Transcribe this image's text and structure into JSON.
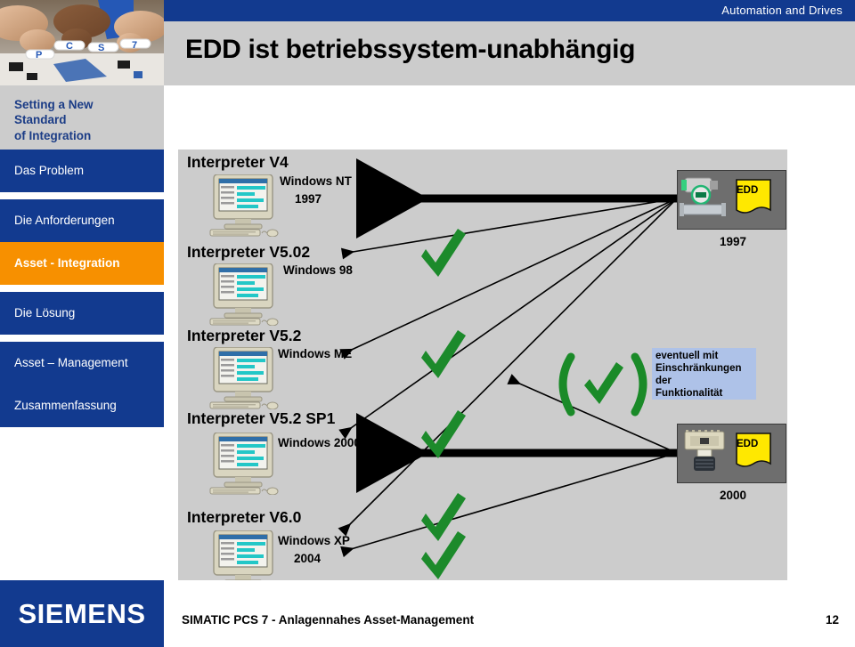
{
  "header": {
    "eyebrow": "Automation and Drives",
    "title": "EDD ist betriebssystem-unabhängig"
  },
  "sidebar": {
    "heading_lines": [
      "Setting a New",
      "Standard",
      "of Integration"
    ],
    "items": [
      {
        "label": "Das Problem",
        "state": "normal"
      },
      {
        "label": "Die Anforderungen",
        "state": "normal"
      },
      {
        "label": "Asset - Integration",
        "state": "active"
      },
      {
        "label": "Die Lösung",
        "state": "normal"
      },
      {
        "label": "Asset – Management",
        "state": "normal"
      },
      {
        "label": "Zusammenfassung",
        "state": "normal"
      }
    ]
  },
  "footer": {
    "text": "SIMATIC PCS 7  -  Anlagennahes Asset-Management",
    "page": "12",
    "logo": "SIEMENS"
  },
  "diagram": {
    "interpreters": [
      {
        "name": "Interpreter V4",
        "os": "Windows NT",
        "year": "1997"
      },
      {
        "name": "Interpreter V5.02",
        "os": "Windows 98",
        "year": ""
      },
      {
        "name": "Interpreter V5.2",
        "os": "Windows ME",
        "year": ""
      },
      {
        "name": "Interpreter V5.2 SP1",
        "os": "Windows 2000",
        "year": ""
      },
      {
        "name": "Interpreter V6.0",
        "os": "Windows XP",
        "year": "2004"
      }
    ],
    "edd_devices": [
      {
        "label": "EDD",
        "year": "1997",
        "device": "flow-transmitter"
      },
      {
        "label": "EDD",
        "year": "2000",
        "device": "valve-positioner"
      }
    ],
    "note_lines": [
      "eventuell mit",
      "Einschränkungen",
      "der",
      "Funktionalität"
    ],
    "checkmark_count": 5,
    "paren_check": "(✓)"
  },
  "colors": {
    "siemens_blue": "#123a8f",
    "accent_orange": "#f79000",
    "panel_grey": "#cccccc",
    "check_green": "#1c8a2b",
    "edd_yellow": "#ffe800",
    "note_blue": "#aec2e8"
  }
}
